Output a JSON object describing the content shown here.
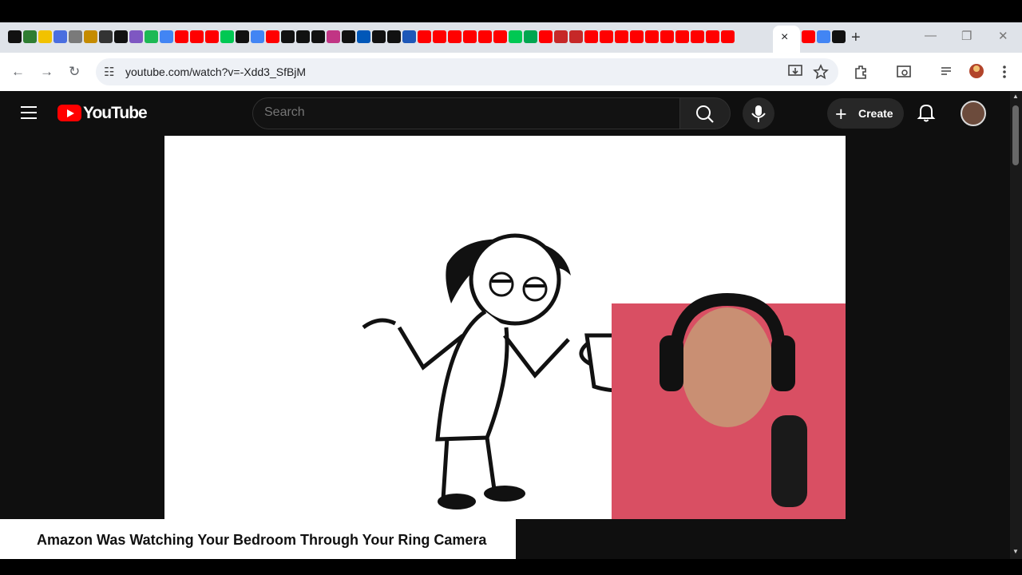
{
  "browser": {
    "url": "youtube.com/watch?v=-Xdd3_SfBjM",
    "tab_close": "×",
    "new_tab": "+",
    "window_minimize": "—",
    "window_restore": "❐",
    "window_close": "✕",
    "back": "←",
    "forward": "→",
    "reload": "↻",
    "site_info": "☷",
    "tab_icon_colors": [
      "#111111",
      "#2f7d32",
      "#f2c200",
      "#4a6ee0",
      "#7a7a7a",
      "#c58b00",
      "#333333",
      "#111111",
      "#7e57c2",
      "#1db954",
      "#4285f4",
      "#ff0000",
      "#ff0000",
      "#ff0000",
      "#00c853",
      "#111111",
      "#4285f4",
      "#ff0000",
      "#111111",
      "#111111",
      "#111111",
      "#c13584",
      "#111111",
      "#0057b8",
      "#111111",
      "#111111",
      "#1d57b8",
      "#ff0000",
      "#ff0000",
      "#ff0000",
      "#ff0000",
      "#ff0000",
      "#ff0000",
      "#00c853",
      "#00a650",
      "#ff0000",
      "#c62828",
      "#c62828",
      "#ff0000",
      "#ff0000",
      "#ff0000",
      "#ff0000",
      "#ff0000",
      "#ff0000",
      "#ff0000",
      "#ff0000",
      "#ff0000",
      "#ff0000"
    ],
    "trail_icon_colors": [
      "#ff0000",
      "#4285f4",
      "#111111"
    ]
  },
  "youtube": {
    "brand": "YouTube",
    "search_placeholder": "Search",
    "create_label": "Create",
    "create_plus": "+"
  },
  "video": {
    "title": "Amazon Was Watching Your Bedroom Through Your Ring Camera"
  },
  "scroll": {
    "up": "▲",
    "down": "▼"
  }
}
